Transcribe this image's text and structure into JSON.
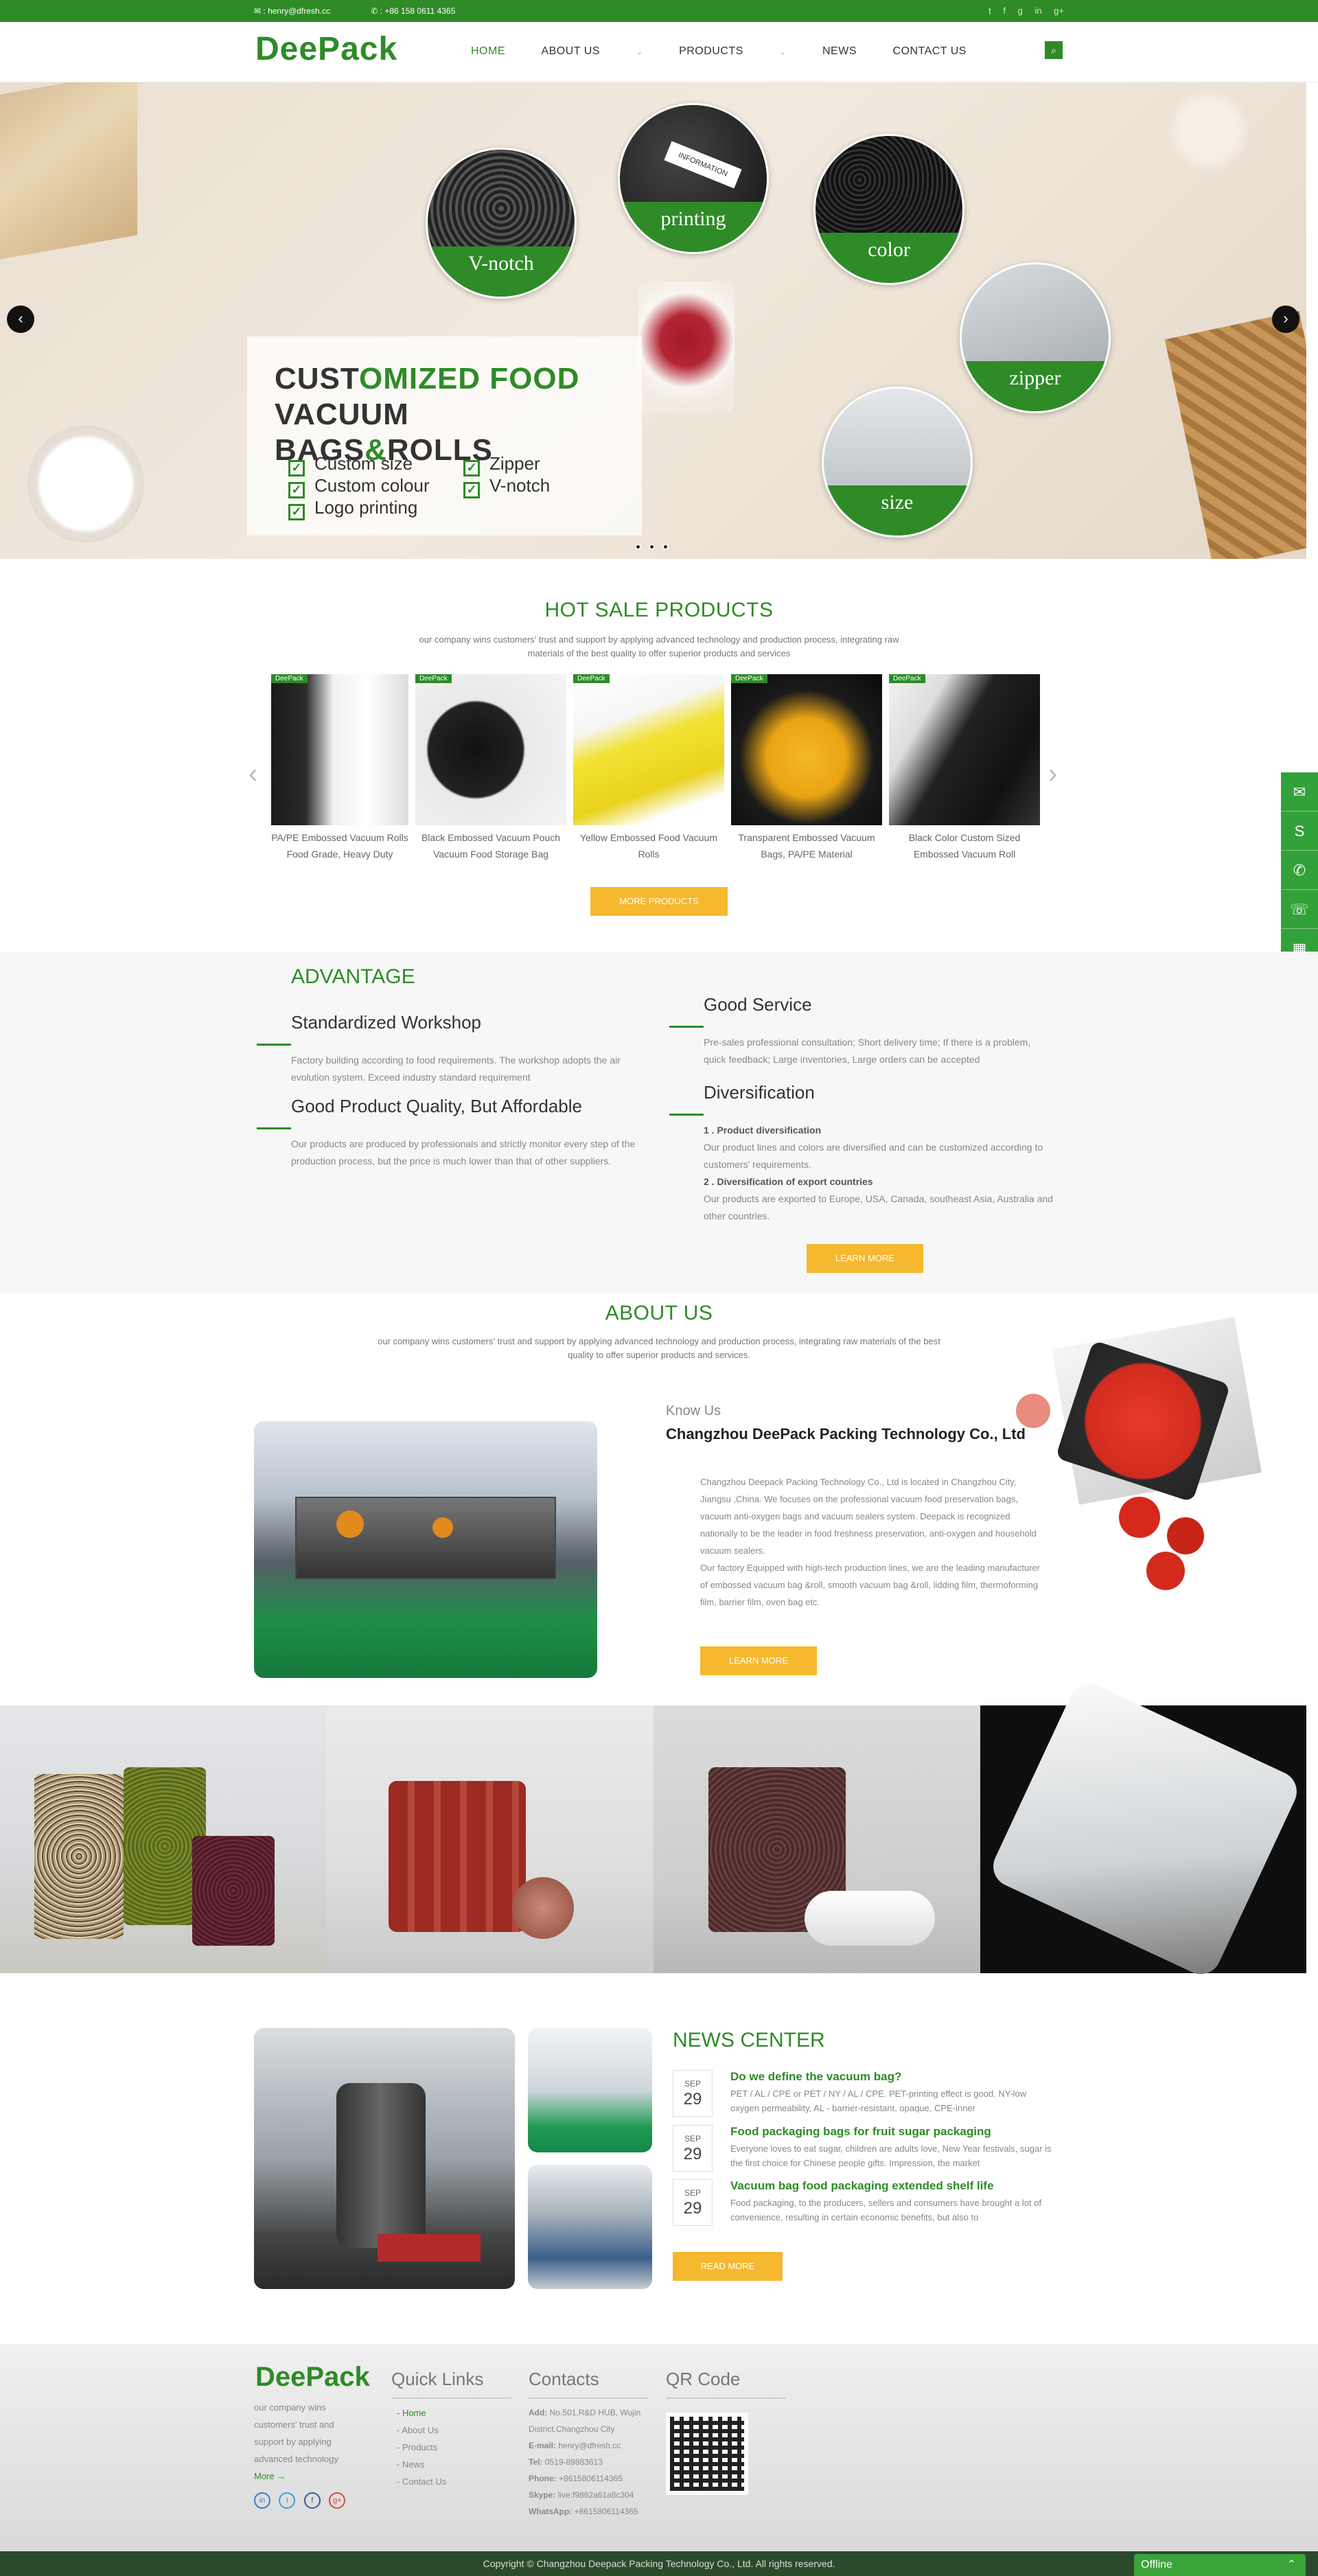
{
  "topbar": {
    "email": "henry@dfresh.cc",
    "phone": "+86 158 0611 4365",
    "social": [
      "twitter-icon",
      "facebook-icon",
      "google-icon",
      "linkedin-icon",
      "googleplus-icon"
    ]
  },
  "header": {
    "logo": "DeePack",
    "nav": [
      "HOME",
      "ABOUT US",
      "PRODUCTS",
      "NEWS",
      "CONTACT US"
    ],
    "search_icon": "search-icon"
  },
  "banner": {
    "title_a": "CUST",
    "title_b": "OMIZED FOOD",
    "title_c": " VACUUM",
    "title_d": "BAGS",
    "title_e": "&",
    "title_f": "ROLLS",
    "features": [
      "Custom size",
      "Custom colour",
      "Logo printing",
      "Zipper",
      "V-notch"
    ],
    "circles": [
      "V-notch",
      "printing",
      "color",
      "zipper",
      "size"
    ],
    "card_text": "INFORMATION",
    "slides": 3,
    "active_slide": 3
  },
  "hot": {
    "title": "HOT SALE PRODUCTS",
    "subtitle": "our company wins customers' trust and support by applying advanced technology and production process, integrating raw materials of the best quality to offer superior products and services",
    "products": [
      {
        "tag": "DeePack",
        "caption": "PA/PE Embossed Vacuum Rolls Food Grade, Heavy Duty"
      },
      {
        "tag": "DeePack",
        "caption": "Black Embossed Vacuum Pouch Vacuum Food Storage Bag"
      },
      {
        "tag": "DeePack",
        "caption": "Yellow Embossed Food Vacuum Rolls"
      },
      {
        "tag": "DeePack",
        "caption": "Transparent Embossed Vacuum Bags, PA/PE Material"
      },
      {
        "tag": "DeePack",
        "caption": "Black Color Custom Sized Embossed Vacuum Roll"
      }
    ],
    "more": "MORE PRODUCTS"
  },
  "advantage": {
    "title": "ADVANTAGE",
    "items": [
      {
        "h": "Standardized Workshop",
        "p": "Factory building according to food requirements. The workshop adopts the air evolution system. Exceed industry standard requirement"
      },
      {
        "h": "Good Product Quality, But Affordable",
        "p": "Our products are produced by professionals and strictly monitor every step of the production process, but the price is much lower than that of other suppliers."
      },
      {
        "h": "Good Service",
        "p": "Pre-sales professional consultation; Short delivery time; If there is a problem, quick feedback; Large inventories, Large orders can be accepted"
      },
      {
        "h": "Diversification",
        "s1": "1 . Product diversification",
        "p1": "Our product lines and colors are diversified and can be customized according to customers' requirements.",
        "s2": "2 . Diversification of export countries",
        "p2": "Our products are exported to Europe, USA, Canada, southeast Asia, Australia and other countries."
      }
    ],
    "learn": "LEARN MORE"
  },
  "about": {
    "title": "ABOUT US",
    "subtitle": "our company wins customers' trust and support by applying advanced technology and production process, integrating raw materials of the best quality to offer superior products and services.",
    "know": "Know Us",
    "company": "Changzhou DeePack Packing Technology Co., Ltd",
    "text": "Changzhou Deepack Packing Technology Co., Ltd is located in Changzhou City, Jiangsu ,China. We focuses on the professional vacuum food preservation bags, vacuum anti-oxygen bags and vacuum sealers system. Deepack is recognized nationally to be the leader in food freshness preservation, anti-oxygen and household vacuum sealers.",
    "text2": "Our factory Equipped with high-tech production lines, we are the leading manufacturer of embossed vacuum bag &roll, smooth vacuum bag &roll, lidding film, thermoforming film, barrier film, oven bag etc.",
    "learn": "LEARN MORE"
  },
  "news": {
    "title": "NEWS CENTER",
    "items": [
      {
        "m": "SEP",
        "d": "29",
        "t": "Do we define the vacuum bag?",
        "p": "PET / AL / CPE or PET / NY / AL / CPE. PET-printing effect is good. NY-low oxygen permeability, AL - barrier-resistant, opaque, CPE-inner"
      },
      {
        "m": "SEP",
        "d": "29",
        "t": "Food packaging bags for fruit sugar packaging",
        "p": "Everyone loves to eat sugar, children are adults love, New Year festivals, sugar is the first choice for Chinese people gifts. Impression, the market"
      },
      {
        "m": "SEP",
        "d": "29",
        "t": "Vacuum bag food packaging extended shelf life",
        "p": "Food packaging, to the producers, sellers and consumers have brought a lot of convenience, resulting in certain economic benefits, but also to"
      }
    ],
    "more": "READ MORE"
  },
  "footer": {
    "logo": "DeePack",
    "desc": "our company wins customers' trust and support by applying advanced technology",
    "more": "More →",
    "ql_title": "Quick Links",
    "links": [
      "- Home",
      "- About Us",
      "- Products",
      "- News",
      "- Contact Us"
    ],
    "ct_title": "Contacts",
    "contacts": [
      {
        "k": "Add:",
        "v": "No.501,R&D HUB, Wujin District,Changzhou City"
      },
      {
        "k": "E-mail:",
        "v": "henry@dfresh.cc"
      },
      {
        "k": "Tel:",
        "v": "0519-89883613"
      },
      {
        "k": "Phone:",
        "v": "+8615806114365"
      },
      {
        "k": "Skype:",
        "v": "live:f9862a61a8c304"
      },
      {
        "k": "WhatsApp:",
        "v": "+8615806114365"
      }
    ],
    "qr_title": "QR Code"
  },
  "copyright": "Copyright © Changzhou Deepack Packing Technology Co., Ltd. All rights reserved.",
  "offline": "Offline",
  "sidebar": [
    "mail-icon",
    "skype-icon",
    "whatsapp-icon",
    "phone-icon",
    "qrcode-icon"
  ],
  "colors": {
    "green": "#2e8b27",
    "yellow": "#f5b82e"
  }
}
